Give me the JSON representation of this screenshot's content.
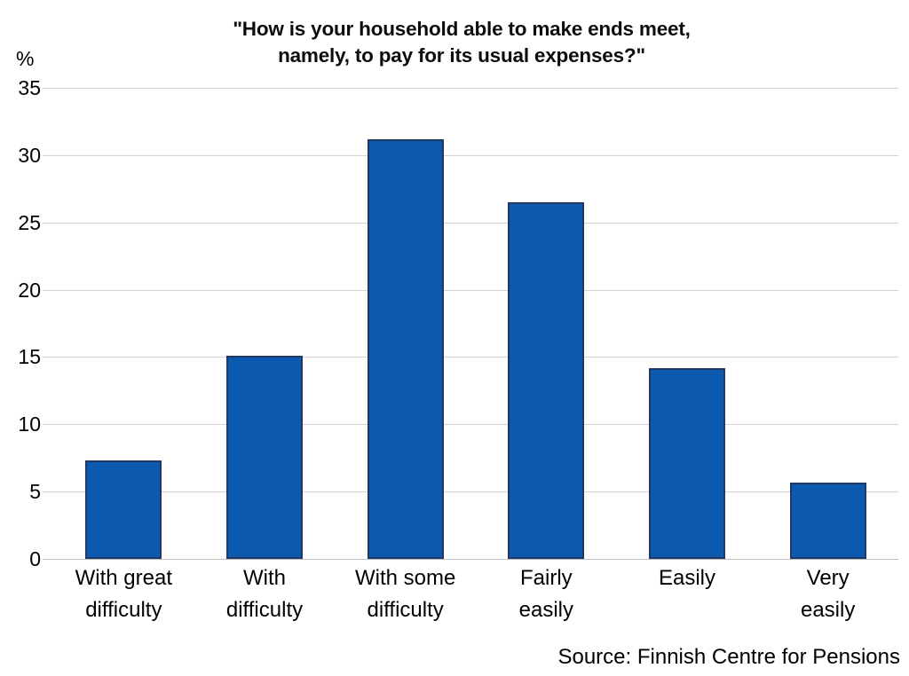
{
  "chart_data": {
    "type": "bar",
    "title": "\"How is your household able to make ends meet, namely, to pay for its usual expenses?\"",
    "title_lines": [
      "\"How is your household able to make ends meet,",
      "namely, to pay for its usual expenses?\""
    ],
    "categories": [
      "With great difficulty",
      "With difficulty",
      "With some difficulty",
      "Fairly easily",
      "Easily",
      "Very easily"
    ],
    "category_lines": [
      [
        "With great",
        "difficulty"
      ],
      [
        "With",
        "difficulty"
      ],
      [
        "With some",
        "difficulty"
      ],
      [
        "Fairly",
        "easily"
      ],
      [
        "Easily",
        ""
      ],
      [
        "Very",
        "easily"
      ]
    ],
    "values": [
      7.3,
      15.1,
      31.2,
      26.5,
      14.2,
      5.7
    ],
    "xlabel": "",
    "ylabel": "%",
    "y_unit": "%",
    "ylim": [
      0,
      35
    ],
    "y_ticks": [
      0,
      5,
      10,
      15,
      20,
      25,
      30,
      35
    ],
    "y_tick_labels": [
      "0",
      "5",
      "10",
      "15",
      "20",
      "25",
      "30",
      "35"
    ],
    "grid": true,
    "legend": false,
    "legend_position": "none",
    "bar_color": "#0b5aaf",
    "bar_border_color": "#1f3864",
    "gridline_color": "#d4d4d4"
  },
  "source": {
    "text": "Source: Finnish Centre for Pensions"
  }
}
